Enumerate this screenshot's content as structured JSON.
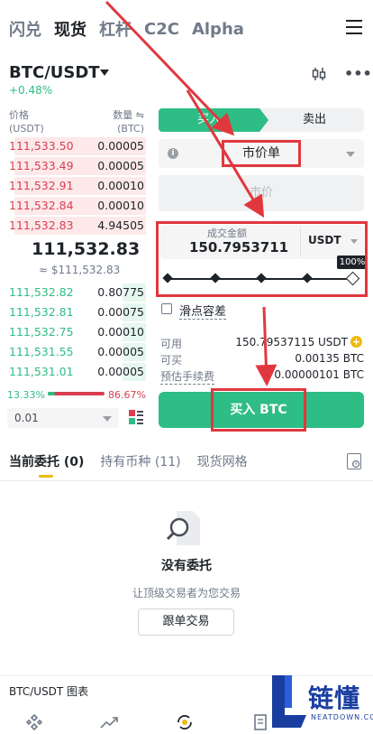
{
  "nav": {
    "tabs": [
      {
        "label": "闪兑",
        "active": false
      },
      {
        "label": "现货",
        "active": true
      },
      {
        "label": "杠杆",
        "active": false
      },
      {
        "label": "C2C",
        "active": false
      },
      {
        "label": "Alpha",
        "active": false
      }
    ]
  },
  "pair": {
    "symbol": "BTC/USDT",
    "change": "+0.48%"
  },
  "orderbook": {
    "price_header": "价格",
    "price_unit": "(USDT)",
    "qty_header": "数量 ⇋",
    "qty_unit": "(BTC)",
    "asks": [
      {
        "price": "111,533.50",
        "qty": "0.00005",
        "depth": 0.9
      },
      {
        "price": "111,533.49",
        "qty": "0.00005",
        "depth": 0.9
      },
      {
        "price": "111,532.91",
        "qty": "0.00010",
        "depth": 0.9
      },
      {
        "price": "111,532.84",
        "qty": "0.00010",
        "depth": 0.9
      },
      {
        "price": "111,532.83",
        "qty": "4.94505",
        "depth": 0.9
      }
    ],
    "mid_price": "111,532.83",
    "mid_fiat": "≈ $111,532.83",
    "bids": [
      {
        "price": "111,532.82",
        "qty": "0.80775",
        "depth": 0.16
      },
      {
        "price": "111,532.81",
        "qty": "0.00075",
        "depth": 0.16
      },
      {
        "price": "111,532.75",
        "qty": "0.00010",
        "depth": 0.16
      },
      {
        "price": "111,531.55",
        "qty": "0.00005",
        "depth": 0.16
      },
      {
        "price": "111,531.01",
        "qty": "0.00005",
        "depth": 0.16
      }
    ],
    "buy_ratio": "13.33%",
    "sell_ratio": "86.67%",
    "buy_ratio_value": 0.1333,
    "precision": "0.01"
  },
  "trade": {
    "buy_tab": "买入",
    "sell_tab": "卖出",
    "order_type": "市价单",
    "price_placeholder": "市价",
    "amount_label": "成交金额",
    "amount_value": "150.7953711",
    "amount_unit": "USDT",
    "slider_tip": "100%",
    "slider_value": 1.0,
    "slippage_label": "滑点容差",
    "available_label": "可用",
    "available_value": "150.79537115 USDT",
    "can_buy_label": "可买",
    "can_buy_value": "0.00135 BTC",
    "fee_label": "预估手续费",
    "fee_value": "0.00000101 BTC",
    "buy_button": "买入 BTC"
  },
  "orders": {
    "tabs": [
      {
        "label": "当前委托 (0)",
        "active": true
      },
      {
        "label": "持有币种 (11)",
        "active": false
      },
      {
        "label": "现货网格",
        "active": false
      }
    ],
    "empty_title": "没有委托",
    "empty_sub": "让顶级交易者为您交易",
    "copy_button": "跟单交易"
  },
  "chart_footer": "BTC/USDT 图表",
  "watermark": {
    "text": "链懂",
    "sub": "NEATDOWN.COM"
  },
  "colors": {
    "green": "#2ebd85",
    "red": "#d83e4f",
    "annotation": "#e0383e",
    "yellow": "#f0b90b"
  }
}
